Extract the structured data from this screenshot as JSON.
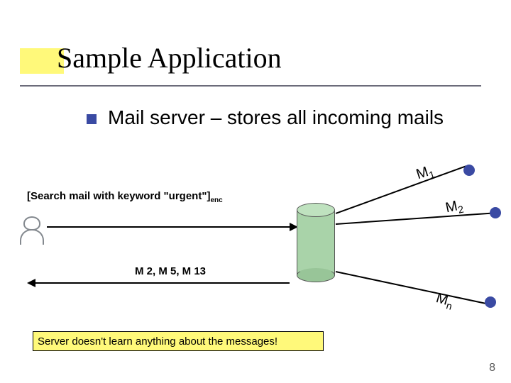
{
  "title": "Sample Application",
  "bullet": "Mail server – stores all incoming mails",
  "query": {
    "text": "[Search mail with keyword \"urgent\"]",
    "sub": "enc"
  },
  "reply": "M 2, M 5, M 13",
  "messages": {
    "m1": {
      "prefix": "M",
      "sub": "1"
    },
    "m2": {
      "prefix": "M",
      "sub": "2"
    },
    "mn": {
      "prefix": "M",
      "sub": "n"
    }
  },
  "callout": "Server doesn't learn anything about the messages!",
  "page_number": "8"
}
